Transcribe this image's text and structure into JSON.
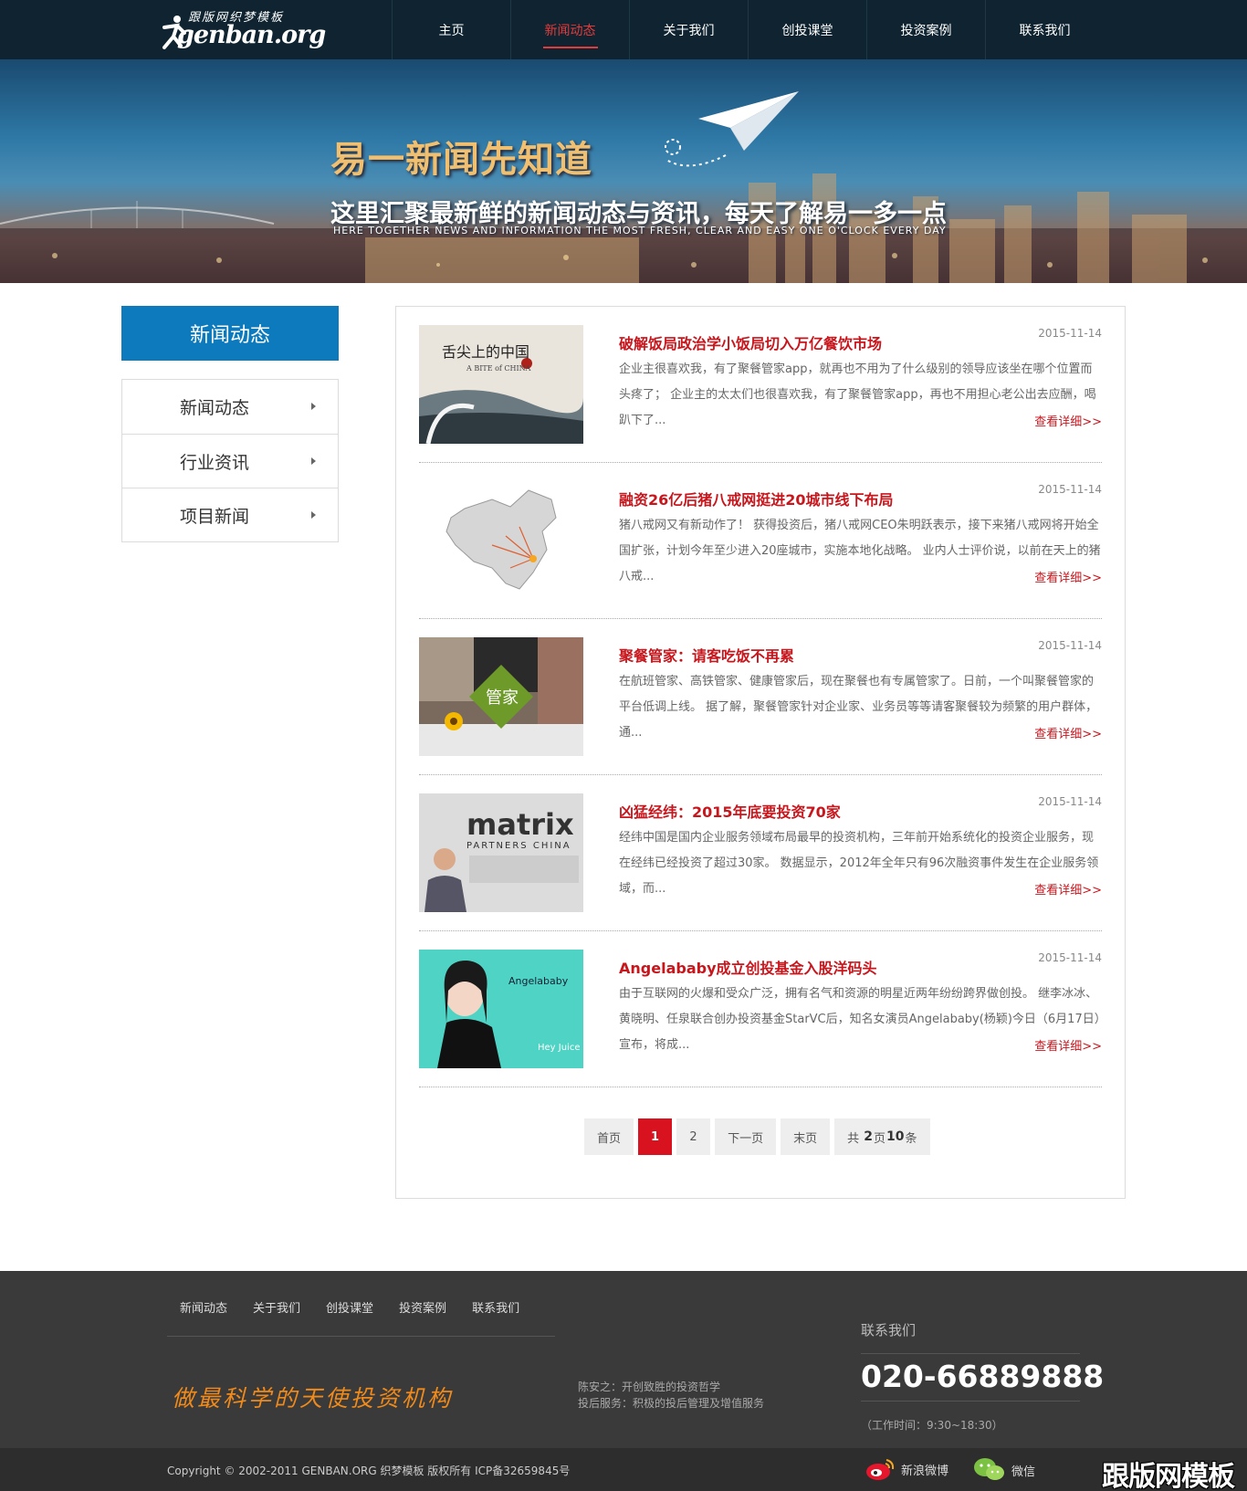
{
  "header": {
    "logo_sub": "跟版网织梦模板",
    "logo_main": "genban.org",
    "nav": [
      "主页",
      "新闻动态",
      "关于我们",
      "创投课堂",
      "投资案例",
      "联系我们"
    ],
    "active_index": 1,
    "active_color": "#e53a3a"
  },
  "banner": {
    "title": "易一新闻先知道",
    "subtitle": "这里汇聚最新鲜的新闻动态与资讯，每天了解易一多一点",
    "english": "Here together news and information the most fresh, clear and easy one o'clock every day"
  },
  "sidebar": {
    "title": "新闻动态",
    "title_color": "#0c7abd",
    "items": [
      "新闻动态",
      "行业资讯",
      "项目新闻"
    ]
  },
  "news": [
    {
      "title": "破解饭局政治学小饭局切入万亿餐饮市场",
      "date": "2015-11-14",
      "desc": "企业主很喜欢我，有了聚餐管家app，就再也不用为了什么级别的领导应该坐在哪个位置而头疼了； 企业主的太太们也很喜欢我，有了聚餐管家app，再也不用担心老公出去应酬，喝趴下了...",
      "more": "查看详细>>",
      "thumb_icon": "bite-of-china-image",
      "thumb_text": "舌尖上的中国",
      "thumb_text2": "A BITE of CHINA"
    },
    {
      "title": "融资26亿后猪八戒网挺进20城市线下布局",
      "date": "2015-11-14",
      "desc": "猪八戒网又有新动作了！ 获得投资后，猪八戒网CEO朱明跃表示，接下来猪八戒网将开始全国扩张，计划今年至少进入20座城市，实施本地化战略。 业内人士评价说，以前在天上的猪八戒...",
      "more": "查看详细>>",
      "thumb_icon": "china-map-image",
      "thumb_text": "",
      "thumb_text2": ""
    },
    {
      "title": "聚餐管家：请客吃饭不再累",
      "date": "2015-11-14",
      "desc": "在航班管家、高铁管家、健康管家后，现在聚餐也有专属管家了。日前，一个叫聚餐管家的平台低调上线。 据了解，聚餐管家针对企业家、业务员等等请客聚餐较为频繁的用户群体，通...",
      "more": "查看详细>>",
      "thumb_icon": "dining-butler-image",
      "thumb_text": "管家",
      "thumb_text2": ""
    },
    {
      "title": "凶猛经纬：2015年底要投资70家",
      "date": "2015-11-14",
      "desc": "经纬中国是国内企业服务领域布局最早的投资机构，三年前开始系统化的投资企业服务，现在经纬已经投资了超过30家。 数据显示，2012年全年只有96次融资事件发生在企业服务领域，而...",
      "more": "查看详细>>",
      "thumb_icon": "matrix-partners-image",
      "thumb_text": "matrix",
      "thumb_text2": "PARTNERS CHINA"
    },
    {
      "title": "Angelababy成立创投基金入股洋码头",
      "date": "2015-11-14",
      "desc": "由于互联网的火爆和受众广泛，拥有名气和资源的明星近两年纷纷跨界做创投。 继李冰冰、黄晓明、任泉联合创办投资基金StarVC后，知名女演员Angelababy(杨颖)今日（6月17日）宣布，将成...",
      "more": "查看详细>>",
      "thumb_icon": "hey-juice-image",
      "thumb_text": "Angelababy",
      "thumb_text2": "Hey Juice"
    }
  ],
  "pager": {
    "first": "首页",
    "pages": [
      "1",
      "2"
    ],
    "current": "1",
    "next": "下一页",
    "last": "末页",
    "total_prefix": "共",
    "total_pages": "2",
    "total_mid": "页",
    "total_items": "10",
    "total_suffix": "条",
    "accent": "#d8121f"
  },
  "footer": {
    "nav": [
      "新闻动态",
      "关于我们",
      "创投课堂",
      "投资案例",
      "联系我们"
    ],
    "slogan": "做最科学的天使投资机构",
    "mid_lines": [
      "陈安之：开创致胜的投资哲学",
      "投后服务：积极的投后管理及增值服务"
    ],
    "contact_label": "联系我们",
    "phone": "020-66889888",
    "hours": "（工作时间：9:30~18:30）",
    "copyright": "Copyright © 2002-2011 GENBAN.ORG 织梦模板 版权所有 ICP备32659845号",
    "weibo": "新浪微博",
    "wechat": "微信",
    "watermark": "跟版网模板"
  }
}
